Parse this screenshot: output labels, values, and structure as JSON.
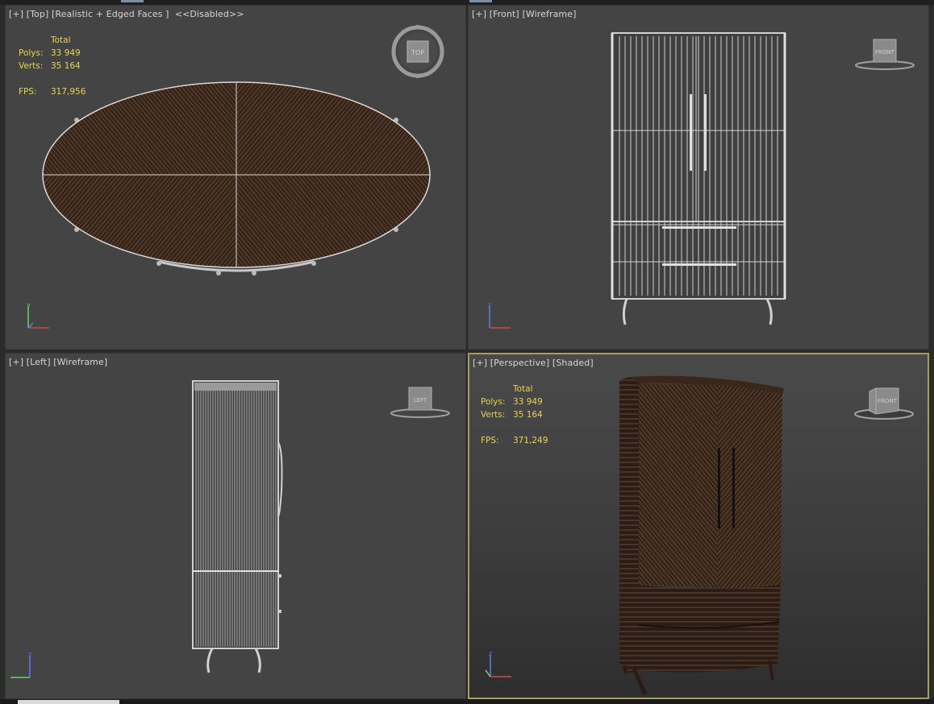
{
  "viewports": {
    "top": {
      "label_plus": "[+]",
      "label_view": "[Top]",
      "label_shading": "[Realistic + Edged Faces ]",
      "label_extra": "<<Disabled>>",
      "stats": {
        "header": "Total",
        "polys_label": "Polys:",
        "polys_value": "33 949",
        "verts_label": "Verts:",
        "verts_value": "35 164",
        "fps_label": "FPS:",
        "fps_value": "317,956"
      },
      "viewcube_label": "TOP"
    },
    "front": {
      "label_plus": "[+]",
      "label_view": "[Front]",
      "label_shading": "[Wireframe]",
      "viewcube_label": "FRONT"
    },
    "left": {
      "label_plus": "[+]",
      "label_view": "[Left]",
      "label_shading": "[Wireframe]",
      "viewcube_label": "LEFT"
    },
    "perspective": {
      "label_plus": "[+]",
      "label_view": "[Perspective]",
      "label_shading": "[Shaded]",
      "stats": {
        "header": "Total",
        "polys_label": "Polys:",
        "polys_value": "33 949",
        "verts_label": "Verts:",
        "verts_value": "35 164",
        "fps_label": "FPS:",
        "fps_value": "371,249"
      },
      "viewcube_label": "FRONT"
    }
  },
  "axis_labels": {
    "x": "x",
    "y": "y",
    "z": "z"
  },
  "colors": {
    "active_border": "#a89c5e",
    "stats_text": "#e7d44a",
    "viewport_bg": "#444444",
    "wood_dark": "#2a1c14",
    "wood_light": "#5a4030"
  }
}
